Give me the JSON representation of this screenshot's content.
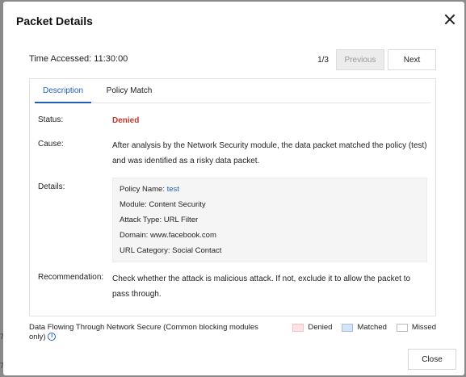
{
  "bg": {
    "frag1": "7",
    "frag2": "7"
  },
  "modal": {
    "title": "Packet Details",
    "time_label": "Time Accessed:",
    "time_value": "11:30:00",
    "pager": {
      "count": "1/3",
      "previous": "Previous",
      "next": "Next"
    },
    "tabs": [
      {
        "label": "Description",
        "active": true
      },
      {
        "label": "Policy Match",
        "active": false
      }
    ],
    "status": {
      "label": "Status:",
      "value": "Denied",
      "color": "#c0392b"
    },
    "cause": {
      "label": "Cause:",
      "value": "After analysis by the Network Security module, the data packet matched the policy (test) and was identified as a risky data packet."
    },
    "details": {
      "label": "Details:",
      "policy_name_label": "Policy Name:",
      "policy_name_value": "test",
      "module": "Module: Content Security",
      "attack_type": "Attack Type: URL Filter",
      "domain": "Domain: www.facebook.com",
      "url_category": "URL Category: Social Contact"
    },
    "recommendation": {
      "label": "Recommendation:",
      "value": "Check whether the attack is malicious attack. If not, exclude it to allow the packet to pass through."
    },
    "legend": {
      "text": "Data Flowing Through Network Secure (Common blocking modules only)",
      "info_icon": "i",
      "items": [
        {
          "label": "Denied",
          "color": "#fde3e3"
        },
        {
          "label": "Matched",
          "color": "#d7e3f7"
        },
        {
          "label": "Missed",
          "color": "#ffffff"
        }
      ]
    },
    "close_button": "Close"
  },
  "colors": {
    "accent": "#1f5fb8",
    "denied": "#c0392b"
  }
}
